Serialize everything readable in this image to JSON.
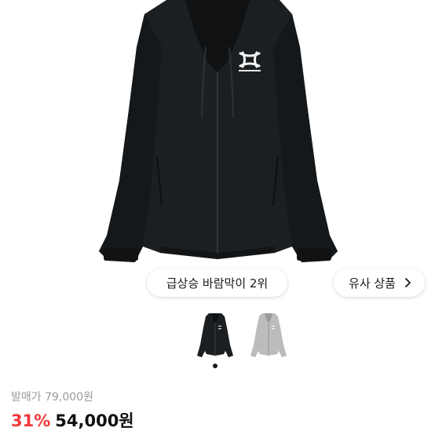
{
  "product": {
    "image_icon": "hooded-windbreaker-jacket-black",
    "brand_logo": "under-armour-logo"
  },
  "chips": {
    "ranking_label": "급상승 바람막이 2위",
    "similar_label": "유사 상품",
    "similar_icon": "chevron-right-icon"
  },
  "thumbnails": [
    {
      "icon": "black-jacket-thumbnail",
      "selected": true
    },
    {
      "icon": "gray-jacket-thumbnail",
      "selected": false
    }
  ],
  "price": {
    "original_label": "발매가",
    "original_value": "79,000원",
    "discount": "31%",
    "sale_value": "54,000원"
  },
  "colors": {
    "discount": "#f2383a",
    "jacket": "#1c1f22",
    "jacket_gray": "#b9b9b9"
  }
}
